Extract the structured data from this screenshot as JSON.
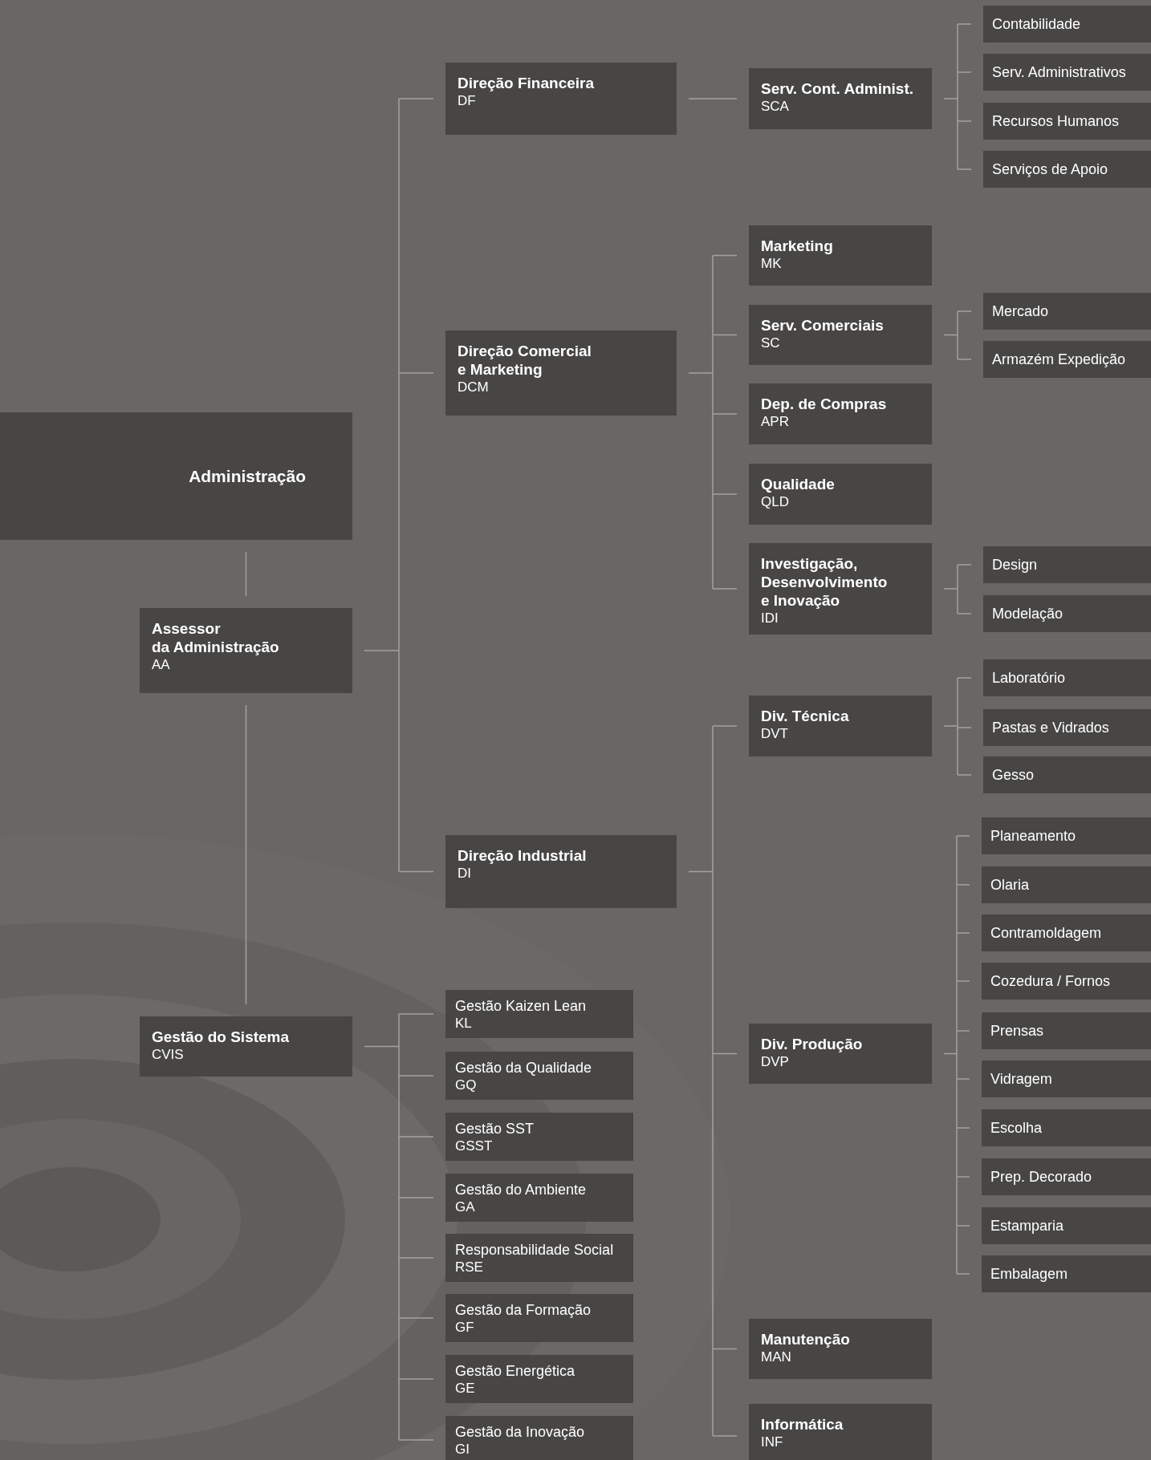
{
  "org_chart": {
    "root": {
      "kind": "head",
      "title": "Administração",
      "children": [
        {
          "kind": "unit",
          "title": "Assessor\nda Administração",
          "code": "AA",
          "children": [
            {
              "kind": "unit",
              "title": "Direção Financeira",
              "code": "DF",
              "children": [
                {
                  "kind": "unit",
                  "title": "Serv. Cont. Administ.",
                  "code": "SCA",
                  "children": [
                    {
                      "kind": "leaf",
                      "title": "Contabilidade"
                    },
                    {
                      "kind": "leaf",
                      "title": "Serv. Administrativos"
                    },
                    {
                      "kind": "leaf",
                      "title": "Recursos Humanos"
                    },
                    {
                      "kind": "leaf",
                      "title": "Serviços de Apoio"
                    }
                  ]
                }
              ]
            },
            {
              "kind": "unit",
              "title": "Direção Comercial\ne Marketing",
              "code": "DCM",
              "children": [
                {
                  "kind": "unit",
                  "title": "Marketing",
                  "code": "MK"
                },
                {
                  "kind": "unit",
                  "title": "Serv. Comerciais",
                  "code": "SC",
                  "children": [
                    {
                      "kind": "leaf",
                      "title": "Mercado"
                    },
                    {
                      "kind": "leaf",
                      "title": "Armazém Expedição"
                    }
                  ]
                },
                {
                  "kind": "unit",
                  "title": "Dep. de Compras",
                  "code": "APR"
                },
                {
                  "kind": "unit",
                  "title": "Qualidade",
                  "code": "QLD"
                },
                {
                  "kind": "unit",
                  "title": "Investigação,\nDesenvolvimento\ne Inovação",
                  "code": "IDI",
                  "children": [
                    {
                      "kind": "leaf",
                      "title": "Design"
                    },
                    {
                      "kind": "leaf",
                      "title": "Modelação"
                    }
                  ]
                }
              ]
            },
            {
              "kind": "unit",
              "title": "Direção Industrial",
              "code": "DI",
              "children": [
                {
                  "kind": "unit",
                  "title": "Div. Técnica",
                  "code": "DVT",
                  "children": [
                    {
                      "kind": "leaf",
                      "title": "Laboratório"
                    },
                    {
                      "kind": "leaf",
                      "title": "Pastas e Vidrados"
                    },
                    {
                      "kind": "leaf",
                      "title": "Gesso"
                    }
                  ]
                },
                {
                  "kind": "unit",
                  "title": "Div. Produção",
                  "code": "DVP",
                  "children": [
                    {
                      "kind": "leaf",
                      "title": "Planeamento"
                    },
                    {
                      "kind": "leaf",
                      "title": "Olaria"
                    },
                    {
                      "kind": "leaf",
                      "title": "Contramoldagem"
                    },
                    {
                      "kind": "leaf",
                      "title": "Cozedura / Fornos"
                    },
                    {
                      "kind": "leaf",
                      "title": "Prensas"
                    },
                    {
                      "kind": "leaf",
                      "title": "Vidragem"
                    },
                    {
                      "kind": "leaf",
                      "title": "Escolha"
                    },
                    {
                      "kind": "leaf",
                      "title": "Prep. Decorado"
                    },
                    {
                      "kind": "leaf",
                      "title": "Estamparia"
                    },
                    {
                      "kind": "leaf",
                      "title": "Embalagem"
                    }
                  ]
                },
                {
                  "kind": "unit",
                  "title": "Manutenção",
                  "code": "MAN"
                },
                {
                  "kind": "unit",
                  "title": "Informática",
                  "code": "INF"
                }
              ]
            },
            {
              "kind": "unit",
              "title": "Gestão do Sistema",
              "code": "CVIS",
              "children": [
                {
                  "kind": "sub",
                  "title": "Gestão Kaizen Lean",
                  "code": "KL"
                },
                {
                  "kind": "sub",
                  "title": "Gestão da Qualidade",
                  "code": "GQ"
                },
                {
                  "kind": "sub",
                  "title": "Gestão SST",
                  "code": "GSST"
                },
                {
                  "kind": "sub",
                  "title": "Gestão do Ambiente",
                  "code": "GA"
                },
                {
                  "kind": "sub",
                  "title": "Responsabilidade Social",
                  "code": "RSE"
                },
                {
                  "kind": "sub",
                  "title": "Gestão da Formação",
                  "code": "GF"
                },
                {
                  "kind": "sub",
                  "title": "Gestão Energética",
                  "code": "GE"
                },
                {
                  "kind": "sub",
                  "title": "Gestão da Inovação",
                  "code": "GI"
                }
              ]
            }
          ]
        }
      ]
    }
  }
}
